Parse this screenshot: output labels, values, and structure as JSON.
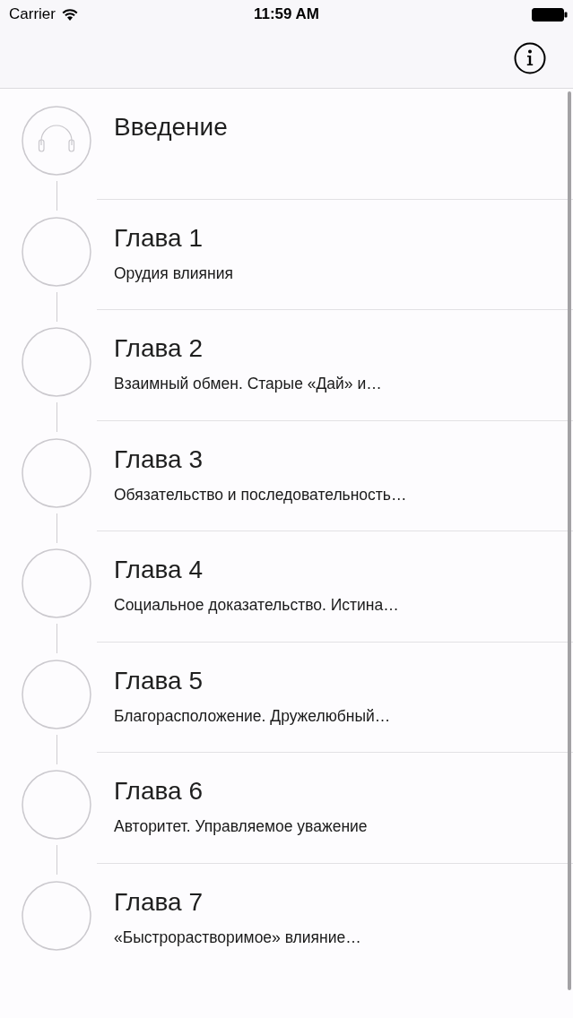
{
  "status_bar": {
    "carrier": "Carrier",
    "time": "11:59 AM"
  },
  "chapters": [
    {
      "kind": "intro",
      "title": "Введение"
    },
    {
      "kind": "chapter",
      "title": "Глава 1",
      "subtitle": "Орудия влияния"
    },
    {
      "kind": "chapter",
      "title": "Глава 2",
      "subtitle": "Взаимный обмен. Старые «Дай» и…"
    },
    {
      "kind": "chapter",
      "title": "Глава 3",
      "subtitle": "Обязательство и последовательность…"
    },
    {
      "kind": "chapter",
      "title": "Глава 4",
      "subtitle": "Социальное доказательство. Истина…"
    },
    {
      "kind": "chapter",
      "title": "Глава 5",
      "subtitle": "Благорасположение. Дружелюбный…"
    },
    {
      "kind": "chapter",
      "title": "Глава 6",
      "subtitle": "Авторитет. Управляемое уважение"
    },
    {
      "kind": "chapter",
      "title": "Глава 7",
      "subtitle": "«Быстрорастворимое» влияние…"
    }
  ]
}
